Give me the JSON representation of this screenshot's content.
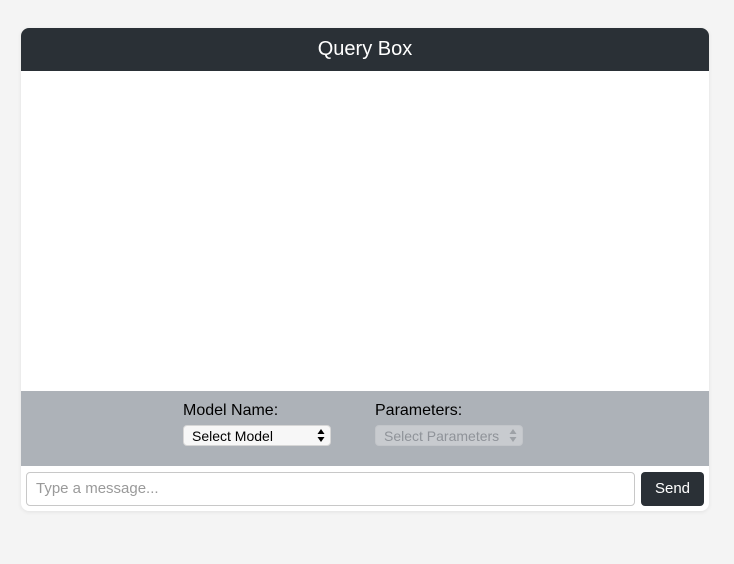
{
  "header": {
    "title": "Query Box"
  },
  "messages": [],
  "controls": {
    "model": {
      "label": "Model Name:",
      "selected": "Select Model"
    },
    "parameters": {
      "label": "Parameters:",
      "selected": "Select Parameters",
      "disabled": true
    }
  },
  "composer": {
    "placeholder": "Type a message...",
    "value": "",
    "send_label": "Send"
  },
  "colors": {
    "header_bg": "#2a3036",
    "controls_bg": "#adb2b8",
    "page_bg": "#f4f4f4",
    "button_bg": "#2a3036"
  },
  "icons": {
    "select_arrows": "chevron-updown-icon"
  }
}
